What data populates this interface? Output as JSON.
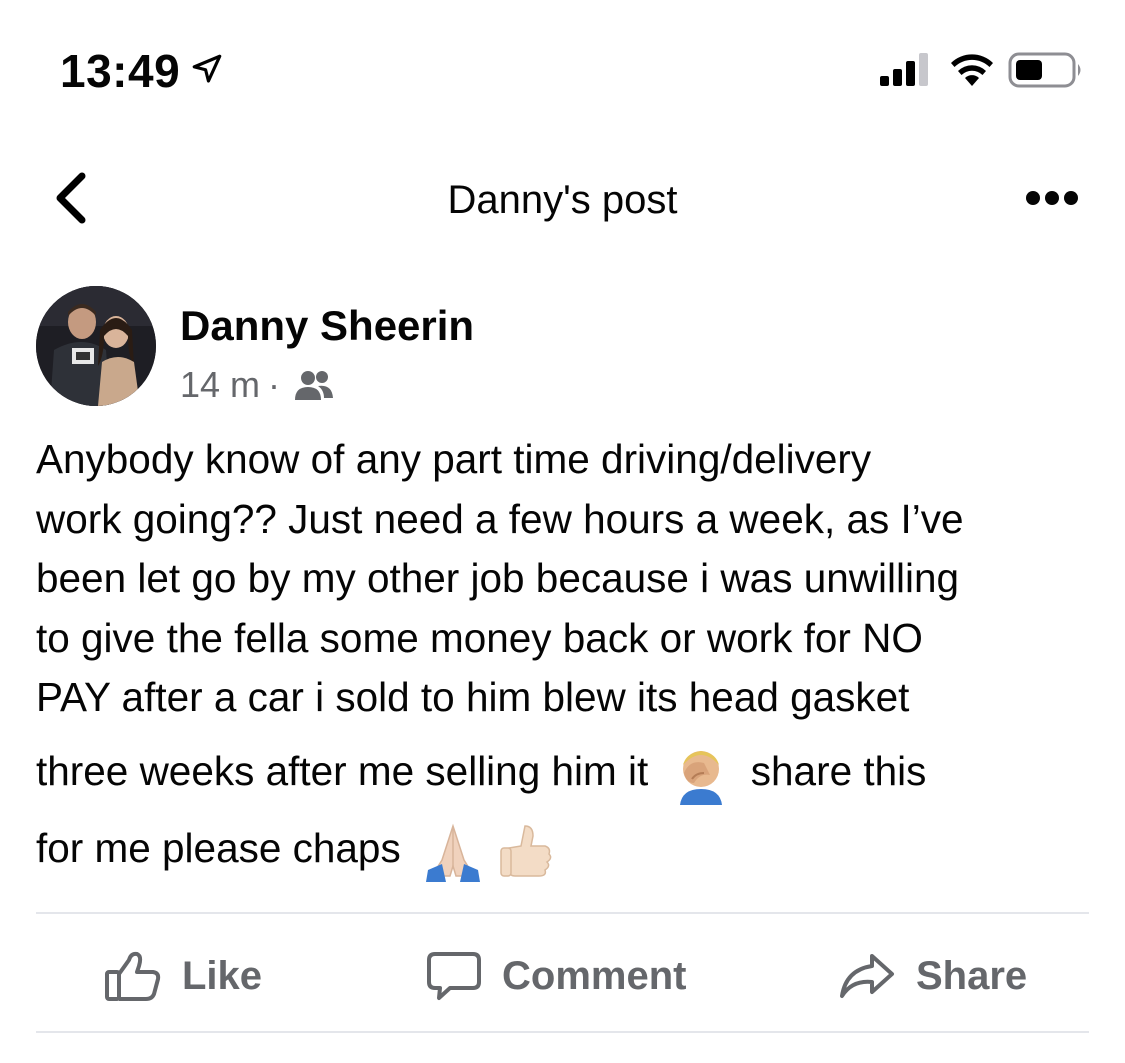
{
  "status_bar": {
    "time": "13:49"
  },
  "header": {
    "title": "Danny's post"
  },
  "post": {
    "author": "Danny Sheerin",
    "time_ago": "14 m",
    "separator": "·",
    "audience_icon": "friends-icon",
    "lines": [
      "Anybody know of any part time driving/delivery",
      "work going?? Just need a few hours a week, as I’ve",
      "been let go by my other job because i was unwilling",
      "to give the fella some money back or work for NO",
      "PAY after a car i sold to him blew its head gasket"
    ],
    "line6_before": "three weeks after me selling him it",
    "line6_after": "share this",
    "line7": "for me please chaps",
    "emojis": [
      "face-palm-emoji",
      "folded-hands-emoji",
      "thumbs-up-emoji"
    ]
  },
  "actions": {
    "like": "Like",
    "comment": "Comment",
    "share": "Share"
  },
  "colors": {
    "text": "#050505",
    "secondary": "#65676b",
    "divider": "#e4e6eb"
  }
}
